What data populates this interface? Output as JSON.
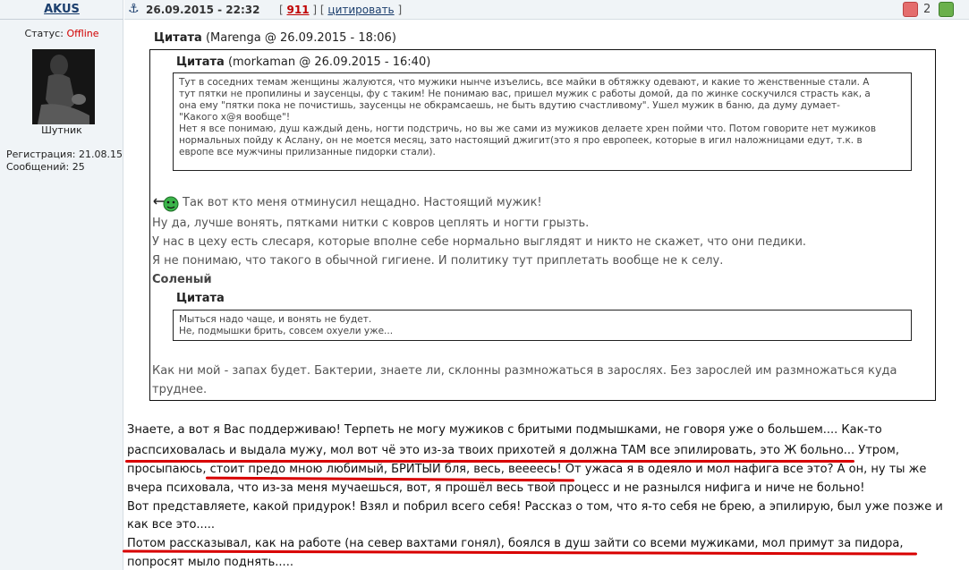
{
  "profile": {
    "username": "AKUS",
    "status_label": "Статус:",
    "status_value": "Offline",
    "rank": "Шутник",
    "registration": "Регистрация: 21.08.15",
    "posts": "Сообщений: 25"
  },
  "post": {
    "datetime": "26.09.2015 - 22:32",
    "bracket_open": "[",
    "post_number": "911",
    "bracket_mid": "] [",
    "quote_link": "цитировать",
    "bracket_close": "]",
    "rating": "2"
  },
  "quote1": {
    "label": "Цитата",
    "meta": "(Marenga @ 26.09.2015 - 18:06)"
  },
  "quote2": {
    "label": "Цитата",
    "meta": "(morkaman @ 26.09.2015 - 16:40)",
    "lines": [
      "Тут в соседних темам женщины жалуются, что мужики нынче изъелись, все майки в обтяжку одевают, и какие то женственные стали. А",
      "тут пятки не пропилины и заусенцы, фу с таким! Не понимаю вас, пришел мужик с работы домой, да по жинке соскучился страсть как, а",
      "она ему \"пятки пока не почистишь, заусенцы не обкрамсаешь, не быть вдутию счастливому\". Ушел мужик в баню, да думу думает-",
      "\"Какого х@я вообще\"!",
      "Нет я все понимаю, душ каждый день, ногти подстричь, но вы же сами из мужиков делаете хрен пойми что. Потом говорите нет мужиков",
      "нормальных пойду к Аслану, он не моется месяц, зато настоящий джигит(это я про европеек, которые в игил наложницами едут, т.к. в",
      "европе все мужчины прилизанные пидорки стали)."
    ]
  },
  "quote1_body": {
    "lines": [
      "Так вот кто меня отминусил нещадно. Настоящий мужик!",
      "Ну да, лучше вонять, пятками нитки с ковров цеплять и ногти грызть.",
      "У нас в цеху есть слесаря, которые вполне себе нормально выглядят и никто не скажет, что они педики.",
      "Я не понимаю, что такого в обычной гигиене. И политику тут приплетать вообще не к селу."
    ],
    "salty": "Соленый",
    "after_lines": [
      "Как ни мой - запах будет. Бактерии, знаете ли, склонны размножаться в зарослях. Без зарослей им размножаться куда",
      "труднее."
    ]
  },
  "quote3": {
    "label": "Цитата",
    "lines": [
      "Мыться надо чаще, и вонять не будет.",
      "Не, подмышки брить, совсем охуели уже..."
    ]
  },
  "main": {
    "lines": [
      "Знаете, а вот я Вас поддерживаю! Терпеть не могу мужиков с бритыми подмышками, не говоря уже о большем.... Как-то",
      "распсиховалась и выдала мужу, мол вот чё это из-за твоих прихотей я должна ТАМ все эпилировать, это Ж больно... Утром,",
      "просыпаюсь, стоит предо мною любимый, БРИТЫЙ бля, весь, веееесь! От ужаса я в одеяло и мол нафига все это? А он, ну ты же",
      "вчера психовала, что из-за меня мучаешься, вот, я прошёл весь твой процесс и не разнылся нифига и ниче не больно!",
      "Вот представляете, какой придурок! Взял и побрил всего себя! Рассказ о том, что я-то себя не брею, а эпилирую, был уже позже и",
      "как все это.....",
      "Потом рассказывал, как на работе (на север вахтами гонял), боялся в душ зайти со всеми мужиками, мол примут за пидора,",
      "попросят мыло поднять....."
    ]
  },
  "colors": {
    "underline": "#d80000",
    "offline": "#d20000",
    "link": "#1b3e6d"
  }
}
